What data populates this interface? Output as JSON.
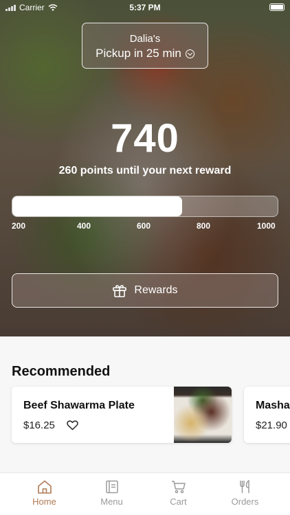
{
  "status_bar": {
    "carrier": "Carrier",
    "time": "5:37 PM"
  },
  "pickup": {
    "location": "Dalia's",
    "time_label": "Pickup in 25 min"
  },
  "loyalty": {
    "points": "740",
    "subtitle": "260 points until your next reward",
    "progress_fraction": 0.64,
    "ticks": [
      "200",
      "400",
      "600",
      "800",
      "1000"
    ]
  },
  "rewards_button": {
    "label": "Rewards"
  },
  "recommended": {
    "title": "Recommended",
    "items": [
      {
        "name": "Beef Shawarma Plate",
        "price": "$16.25"
      },
      {
        "name": "Masha",
        "price": "$21.90"
      }
    ]
  },
  "tabs": [
    {
      "label": "Home",
      "icon": "home-icon"
    },
    {
      "label": "Menu",
      "icon": "menu-icon"
    },
    {
      "label": "Cart",
      "icon": "cart-icon"
    },
    {
      "label": "Orders",
      "icon": "orders-icon"
    }
  ],
  "colors": {
    "accent": "#b07a55",
    "tab_inactive": "#9a9a9a"
  }
}
